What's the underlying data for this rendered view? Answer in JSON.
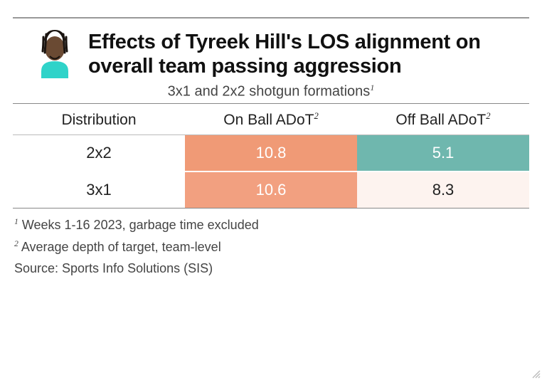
{
  "title": "Effects of Tyreek Hill's LOS alignment on overall team passing aggression",
  "subtitle": "3x1 and 2x2 shotgun formations",
  "subtitle_sup": "1",
  "columns": {
    "c0": "Distribution",
    "c1": "On Ball ADoT",
    "c1_sup": "2",
    "c2": "Off Ball ADoT",
    "c2_sup": "2"
  },
  "rows": [
    {
      "dist": "2x2",
      "on": "10.8",
      "off": "5.1",
      "on_bg": "#f09a76",
      "on_fg": "#ffffff",
      "off_bg": "#6fb7ae",
      "off_fg": "#ffffff"
    },
    {
      "dist": "3x1",
      "on": "10.6",
      "off": "8.3",
      "on_bg": "#f2a080",
      "on_fg": "#ffffff",
      "off_bg": "#fdf3ef",
      "off_fg": "#222222"
    }
  ],
  "footnotes": {
    "f1_sup": "1",
    "f1": " Weeks 1-16 2023, garbage time excluded",
    "f2_sup": "2",
    "f2": " Average depth of target, team-level",
    "source": "Source: Sports Info Solutions (SIS)"
  },
  "chart_data": {
    "type": "table",
    "title": "Effects of Tyreek Hill's LOS alignment on overall team passing aggression",
    "subtitle": "3x1 and 2x2 shotgun formations",
    "columns": [
      "Distribution",
      "On Ball ADoT",
      "Off Ball ADoT"
    ],
    "rows": [
      {
        "Distribution": "2x2",
        "On Ball ADoT": 10.8,
        "Off Ball ADoT": 5.1
      },
      {
        "Distribution": "3x1",
        "On Ball ADoT": 10.6,
        "Off Ball ADoT": 8.3
      }
    ],
    "notes": [
      "Weeks 1-16 2023, garbage time excluded",
      "ADoT = Average depth of target, team-level"
    ],
    "source": "Sports Info Solutions (SIS)",
    "heat_scale": {
      "low_color": "#6fb7ae",
      "high_color": "#f09a76",
      "range": [
        5.1,
        10.8
      ]
    }
  }
}
